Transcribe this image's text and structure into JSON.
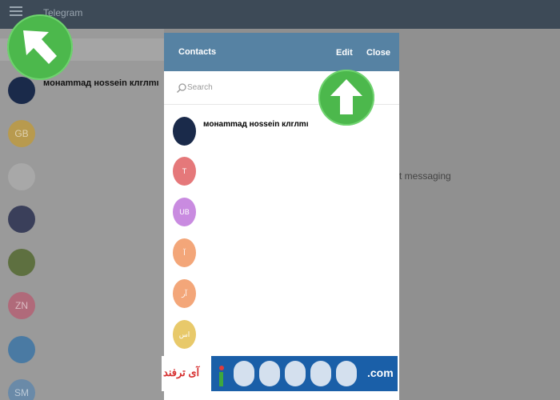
{
  "app": {
    "title": "Telegram"
  },
  "background": {
    "first_chat_name": "мoнammaд нossein клrлmı",
    "avatars": [
      {
        "letters": "",
        "color": "#1a2a4a"
      },
      {
        "letters": "GB",
        "color": "#b89a4e"
      },
      {
        "letters": "",
        "color": "#a8a8a8"
      },
      {
        "letters": "",
        "color": "#3a3f5a"
      },
      {
        "letters": "",
        "color": "#5e7040"
      },
      {
        "letters": "ZN",
        "color": "#b06a7a"
      },
      {
        "letters": "",
        "color": "#4a7aa3"
      },
      {
        "letters": "SM",
        "color": "#6a8aa8"
      }
    ],
    "message_fragment": "t messaging"
  },
  "dialog": {
    "title": "Contacts",
    "edit_label": "Edit",
    "close_label": "Close",
    "search_placeholder": "Search",
    "header_color": "#5682a3",
    "contacts": [
      {
        "name": "мoнammaд нossein клrлmı",
        "initials": "",
        "color": "#1a2a4a"
      },
      {
        "name": "",
        "initials": "T",
        "color": "#e5787a"
      },
      {
        "name": "",
        "initials": "UB",
        "color": "#c98be0"
      },
      {
        "name": "",
        "initials": "آ",
        "color": "#f3a679"
      },
      {
        "name": "",
        "initials": "آر",
        "color": "#f3a679"
      },
      {
        "name": "",
        "initials": "اس",
        "color": "#e8c96a"
      }
    ]
  },
  "overlay": {
    "badge_color": "#4cb84c",
    "watermark_text": "آی ترفند",
    "watermark_suffix": ".com"
  }
}
